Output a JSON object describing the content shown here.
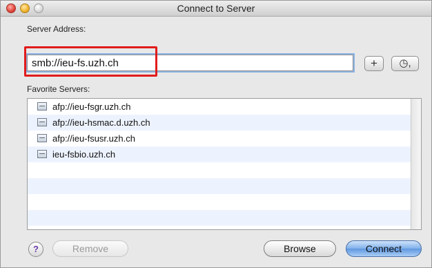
{
  "window": {
    "title": "Connect to Server"
  },
  "server_address": {
    "label": "Server Address:",
    "value": "smb://ieu-fs.uzh.ch",
    "add_button": "+",
    "history_button": "◷,"
  },
  "favorites": {
    "label": "Favorite Servers:",
    "items": [
      {
        "label": "afp://ieu-fsgr.uzh.ch"
      },
      {
        "label": "afp://ieu-hsmac.d.uzh.ch"
      },
      {
        "label": "afp://ieu-fsusr.uzh.ch"
      },
      {
        "label": "ieu-fsbio.uzh.ch"
      }
    ]
  },
  "buttons": {
    "help": "?",
    "remove": "Remove",
    "browse": "Browse",
    "connect": "Connect"
  },
  "colors": {
    "highlight_box": "#e21b1b",
    "default_button": "#7fb0ea",
    "row_stripe": "#edf3fe"
  },
  "icons": {
    "favorite_item": "server-icon",
    "history": "clock-icon"
  }
}
